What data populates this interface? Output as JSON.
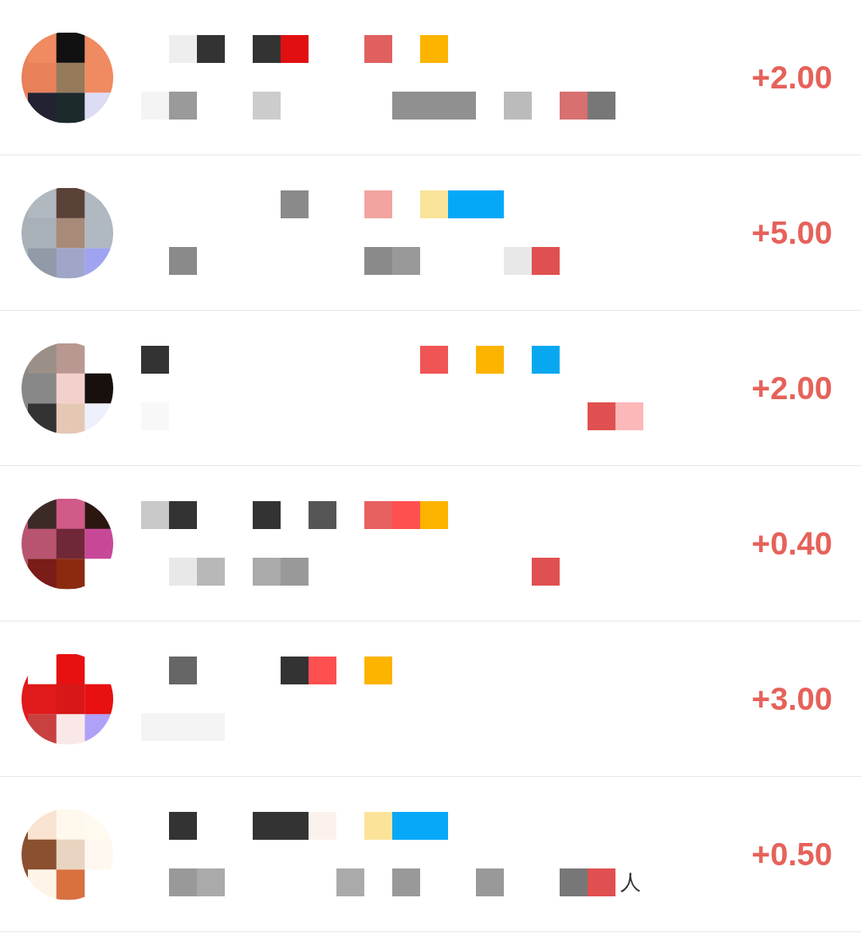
{
  "rows": [
    {
      "amount": "+2.00"
    },
    {
      "amount": "+5.00"
    },
    {
      "amount": "+2.00"
    },
    {
      "amount": "+0.40"
    },
    {
      "amount": "+3.00"
    },
    {
      "amount": "+0.50",
      "tail": "人"
    }
  ]
}
